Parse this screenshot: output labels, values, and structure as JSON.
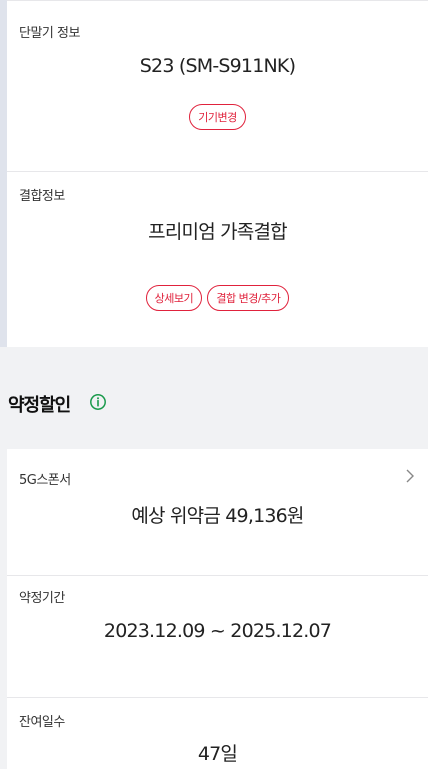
{
  "device": {
    "title": "단말기 정보",
    "model": "S23 (SM-S911NK)",
    "change_button": "기기변경"
  },
  "combo": {
    "title": "결합정보",
    "name": "프리미엄 가족결합",
    "detail_button": "상세보기",
    "change_button": "결합 변경/추가"
  },
  "contract_discount": {
    "title": "약정할인",
    "info_icon": "info-circle-icon",
    "plan": {
      "label": "5G스폰서",
      "value": "예상 위약금 49,136원",
      "chevron_icon": "chevron-right-icon"
    },
    "period": {
      "label": "약정기간",
      "value": "2023.12.09 ~ 2025.12.07"
    },
    "remaining": {
      "label": "잔여일수",
      "value": "47일"
    }
  },
  "colors": {
    "accent": "#e0223c",
    "info": "#1a9a4b"
  }
}
